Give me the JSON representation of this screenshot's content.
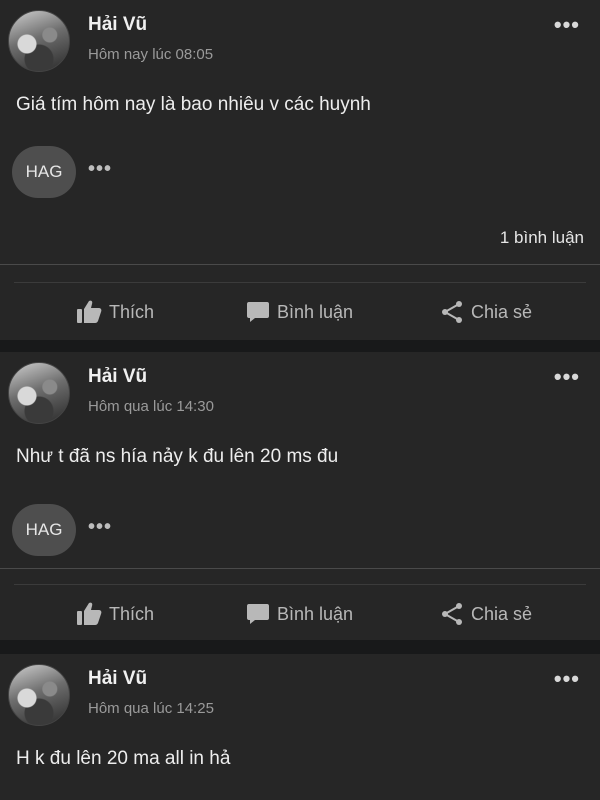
{
  "posts": [
    {
      "author": "Hải Vũ",
      "time": "Hôm nay lúc 08:05",
      "text": "Giá tím hôm nay là bao nhiêu v các huynh",
      "tag": "HAG",
      "comments": "1 bình luận"
    },
    {
      "author": "Hải Vũ",
      "time": "Hôm qua lúc 14:30",
      "text": "Như t đã ns hía nảy k đu lên 20 ms đu",
      "tag": "HAG"
    },
    {
      "author": "Hải Vũ",
      "time": "Hôm qua lúc 14:25",
      "text": "H k đu lên 20 ma all in hả"
    }
  ],
  "actions": {
    "like": "Thích",
    "comment": "Bình luận",
    "share": "Chia sẻ"
  },
  "more_glyph": "•••",
  "icons": {
    "like": "thumbs-up-icon",
    "comment": "speech-bubble-icon",
    "share": "share-icon",
    "more": "more-dots-icon"
  },
  "colors": {
    "background": "#18191a",
    "card": "#262626",
    "text": "#ededed",
    "muted": "#9a9a9a",
    "tag": "#4e4e4e"
  }
}
